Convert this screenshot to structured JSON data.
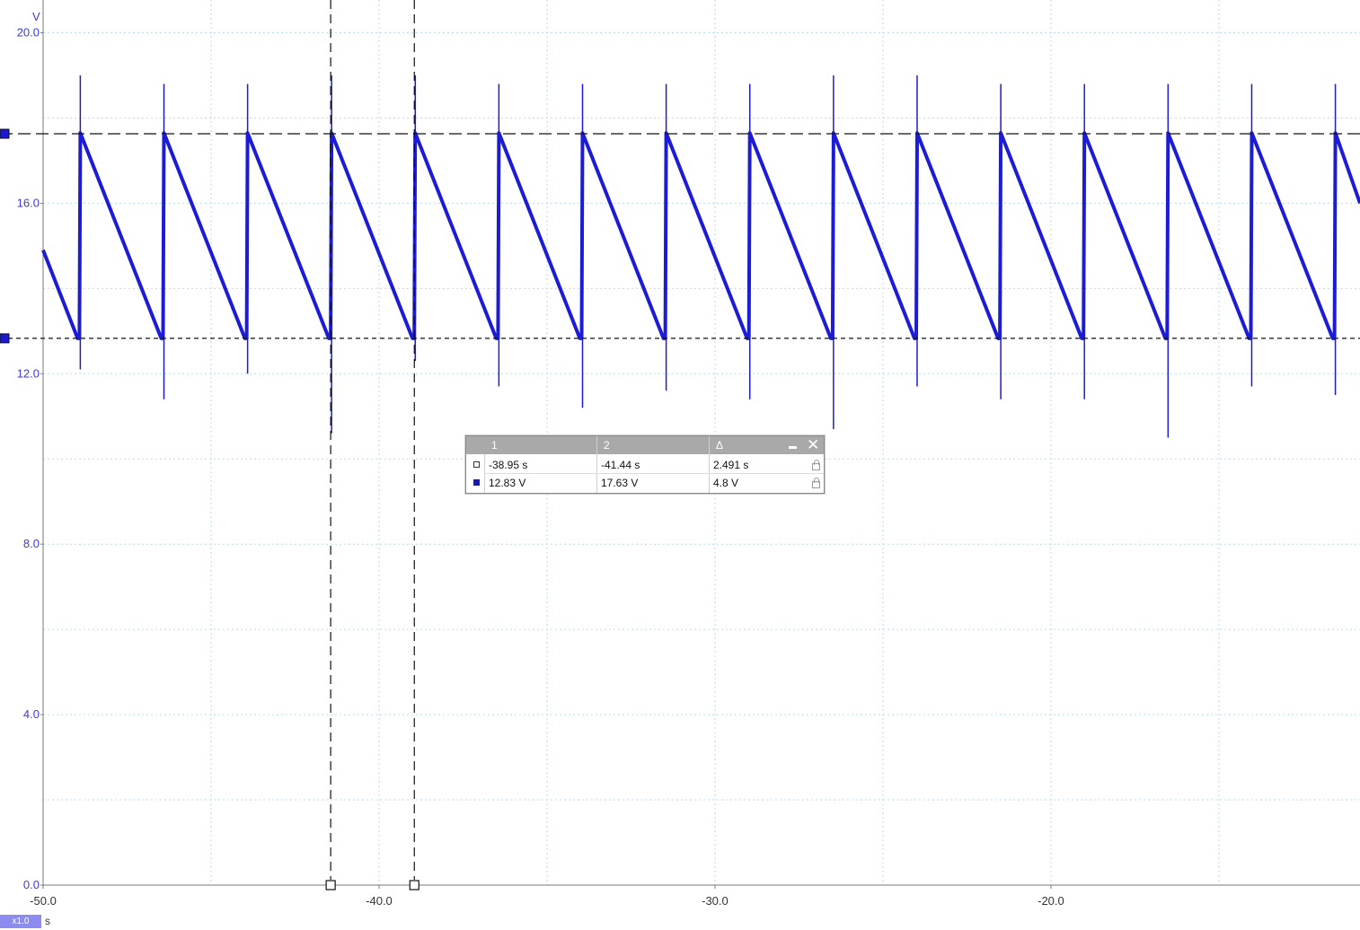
{
  "chart_data": {
    "type": "line",
    "y_unit": "V",
    "x_unit": "s",
    "xlim": [
      -50.0,
      -10.8
    ],
    "ylim": [
      0.0,
      20.6
    ],
    "x_ticks": [
      "-50.0",
      "-40.0",
      "-30.0",
      "-20.0"
    ],
    "y_ticks": [
      "0.0",
      "4.0",
      "8.0",
      "12.0",
      "16.0",
      "20.0"
    ],
    "grid": true,
    "series_color": "#1c1cd6",
    "series": [
      {
        "name": "",
        "sawtooth": {
          "x_start": -50.0,
          "y_start": 14.9,
          "charge_times": [
            -48.92,
            -46.43,
            -43.94,
            -41.44,
            -38.95,
            -36.46,
            -33.97,
            -31.48,
            -28.99,
            -26.5,
            -24.01,
            -21.52,
            -19.03,
            -16.54,
            -14.05,
            -11.56
          ],
          "peak_value": 17.65,
          "trough_value": 12.83,
          "spike_highs": [
            19.0,
            18.8,
            18.8,
            19.0,
            19.0,
            18.8,
            18.8,
            18.8,
            18.8,
            19.0,
            19.0,
            18.8,
            18.8,
            18.8,
            18.8,
            18.8
          ],
          "spike_lows": [
            12.1,
            11.4,
            12.0,
            10.6,
            12.3,
            11.7,
            11.2,
            11.6,
            11.4,
            10.7,
            11.7,
            11.4,
            11.4,
            10.5,
            11.7,
            11.5
          ],
          "end_x": -10.8,
          "end_y": 16.0
        }
      }
    ],
    "cursors": {
      "x1": -41.44,
      "x2": -38.95,
      "y1": 12.83,
      "y2": 17.63
    },
    "zoom_label": "x1.0"
  },
  "readout": {
    "col1": "1",
    "col2": "2",
    "col3": "Δ",
    "row_time": {
      "v1": "-38.95 s",
      "v2": "-41.44 s",
      "delta": "2.491 s"
    },
    "row_volt": {
      "v1": "12.83 V",
      "v2": "17.63 V",
      "delta": "4.8 V"
    },
    "close_icon": "close-icon",
    "minimize_icon": "minimize-icon",
    "lock_icon": "lock-icon",
    "swatch_time_color": "#ffffff",
    "swatch_volt_color": "#1a1aa8"
  }
}
